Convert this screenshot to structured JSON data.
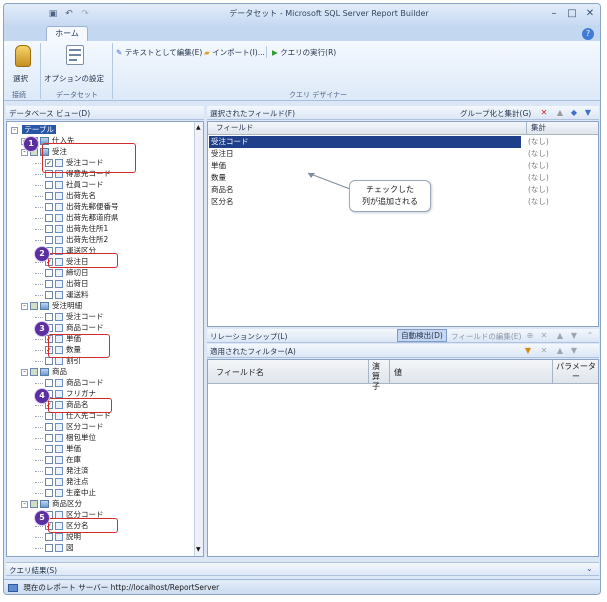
{
  "window": {
    "title": "データセット - Microsoft SQL Server Report Builder",
    "quick_access": [
      "save",
      "undo",
      "redo"
    ]
  },
  "ribbon": {
    "tab_home": "ホーム",
    "btn_select": "選択",
    "btn_options": "オプションの設定",
    "group_connection": "接続",
    "group_dataset": "データセット",
    "btn_edit_as_text": "テキストとして編集(E)",
    "btn_import": "インポート(I)...",
    "btn_run_query": "クエリの実行(R)",
    "group_query_designer": "クエリ デザイナー"
  },
  "db_view": {
    "header": "データベース ビュー(D)",
    "root": "テーブル",
    "rows": [
      {
        "label": "仕入先",
        "level": 1,
        "type": "table",
        "checked": false,
        "expand": "+"
      },
      {
        "label": "受注",
        "level": 1,
        "type": "table",
        "checked": true,
        "expand": "-"
      },
      {
        "label": "受注コード",
        "level": 2,
        "type": "field",
        "checked": true
      },
      {
        "label": "得意先コード",
        "level": 2,
        "type": "field",
        "checked": false
      },
      {
        "label": "社員コード",
        "level": 2,
        "type": "field",
        "checked": false
      },
      {
        "label": "出荷先名",
        "level": 2,
        "type": "field",
        "checked": false
      },
      {
        "label": "出荷先郵便番号",
        "level": 2,
        "type": "field",
        "checked": false
      },
      {
        "label": "出荷先都道府県",
        "level": 2,
        "type": "field",
        "checked": false
      },
      {
        "label": "出荷先住所1",
        "level": 2,
        "type": "field",
        "checked": false
      },
      {
        "label": "出荷先住所2",
        "level": 2,
        "type": "field",
        "checked": false
      },
      {
        "label": "運送区分",
        "level": 2,
        "type": "field",
        "checked": false
      },
      {
        "label": "受注日",
        "level": 2,
        "type": "field",
        "checked": true
      },
      {
        "label": "締切日",
        "level": 2,
        "type": "field",
        "checked": false
      },
      {
        "label": "出荷日",
        "level": 2,
        "type": "field",
        "checked": false
      },
      {
        "label": "運送料",
        "level": 2,
        "type": "field",
        "checked": false
      },
      {
        "label": "受注明細",
        "level": 1,
        "type": "table",
        "checked": true,
        "expand": "-"
      },
      {
        "label": "受注コード",
        "level": 2,
        "type": "field",
        "checked": false
      },
      {
        "label": "商品コード",
        "level": 2,
        "type": "field",
        "checked": false
      },
      {
        "label": "単価",
        "level": 2,
        "type": "field",
        "checked": true
      },
      {
        "label": "数量",
        "level": 2,
        "type": "field",
        "checked": true
      },
      {
        "label": "割引",
        "level": 2,
        "type": "field",
        "checked": false
      },
      {
        "label": "商品",
        "level": 1,
        "type": "table",
        "checked": true,
        "expand": "-"
      },
      {
        "label": "商品コード",
        "level": 2,
        "type": "field",
        "checked": false
      },
      {
        "label": "フリガナ",
        "level": 2,
        "type": "field",
        "checked": false
      },
      {
        "label": "商品名",
        "level": 2,
        "type": "field",
        "checked": true
      },
      {
        "label": "仕入先コード",
        "level": 2,
        "type": "field",
        "checked": false
      },
      {
        "label": "区分コード",
        "level": 2,
        "type": "field",
        "checked": false
      },
      {
        "label": "梱包単位",
        "level": 2,
        "type": "field",
        "checked": false
      },
      {
        "label": "単価",
        "level": 2,
        "type": "field",
        "checked": false
      },
      {
        "label": "在庫",
        "level": 2,
        "type": "field",
        "checked": false
      },
      {
        "label": "発注済",
        "level": 2,
        "type": "field",
        "checked": false
      },
      {
        "label": "発注点",
        "level": 2,
        "type": "field",
        "checked": false
      },
      {
        "label": "生産中止",
        "level": 2,
        "type": "field",
        "checked": false
      },
      {
        "label": "商品区分",
        "level": 1,
        "type": "table",
        "checked": true,
        "expand": "-"
      },
      {
        "label": "区分コード",
        "level": 2,
        "type": "field",
        "checked": false
      },
      {
        "label": "区分名",
        "level": 2,
        "type": "field",
        "checked": true
      },
      {
        "label": "説明",
        "level": 2,
        "type": "field",
        "checked": false
      },
      {
        "label": "図",
        "level": 2,
        "type": "field",
        "checked": false
      }
    ],
    "badges": [
      "1",
      "2",
      "3",
      "4",
      "5"
    ]
  },
  "selected_fields": {
    "header": "選択されたフィールド(F)",
    "group_label": "グループ化と集計(G)",
    "columns": [
      "フィールド",
      "集計"
    ],
    "rows": [
      {
        "field": "受注コード",
        "agg": "(なし)",
        "selected": true
      },
      {
        "field": "受注日",
        "agg": "(なし)",
        "selected": false
      },
      {
        "field": "単価",
        "agg": "(なし)",
        "selected": false
      },
      {
        "field": "数量",
        "agg": "(なし)",
        "selected": false
      },
      {
        "field": "商品名",
        "agg": "(なし)",
        "selected": false
      },
      {
        "field": "区分名",
        "agg": "(なし)",
        "selected": false
      }
    ],
    "callout": "チェックした\n列が追加される"
  },
  "relationships": {
    "header": "リレーションシップ(L)",
    "auto_detect": "自動検出(D)",
    "field_list": "フィールドの編集(E)"
  },
  "filters": {
    "header": "適用されたフィルター(A)",
    "columns": [
      "フィールド名",
      "演算子",
      "値",
      "パラメーター"
    ]
  },
  "query_results": {
    "header": "クエリ結果(S)"
  },
  "status": {
    "text": "現在のレポート サーバー http://localhost/ReportServer"
  }
}
